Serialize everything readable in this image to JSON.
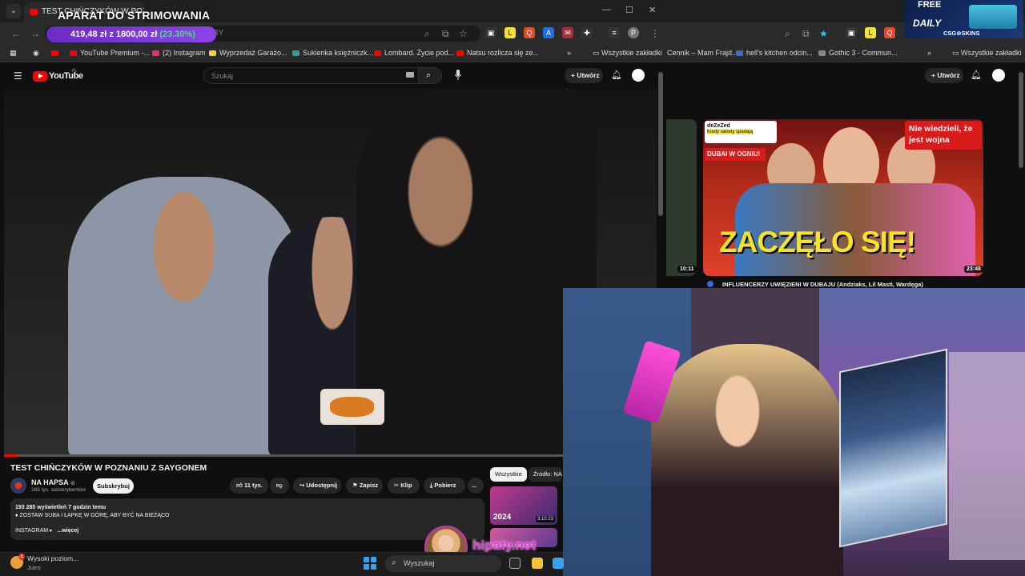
{
  "left_browser": {
    "tab_title": "TEST CHIŃCZYKÓW W POZ",
    "overlay_title": "APARAT DO STRIMOWANIA",
    "address_hint": "tchAggrdBY",
    "money": {
      "amount": "419,48 zł z 1800,00 zł",
      "percent": "(23.30%)"
    },
    "bookmarks": [
      "YouTube Premium -...",
      "(2) Instagram",
      "Wyprzedaż Garażo...",
      "Sukienka księżniczk...",
      "Lombard. Życie pod...",
      "Natsu rozlicza się ze...",
      "Wszystkie zakładki"
    ]
  },
  "youtube": {
    "logo": "YouTube",
    "logo_region": "PL",
    "search_placeholder": "Szukaj",
    "create_label": "Utwórz",
    "video": {
      "title": "TEST CHIŃCZYKÓW W POZNANIU Z SAYGONEM",
      "progress_fraction": 0.02,
      "channel": "NA HAPSA",
      "subscribers": "265 tys. subskrybentów",
      "subscribe_label": "Subskrybuj",
      "likes": "11 tys.",
      "share_label": "Udostępnij",
      "save_label": "Zapisz",
      "clip_label": "Klip",
      "download_label": "Pobierz",
      "more_label": "...",
      "views_time": "193 285 wyświetleń  7 godzin temu",
      "desc_line": "♦ ZOSTAW SUBA I ŁAPKĘ W GÓRĘ, ABY BYĆ NA BIEŻĄCO",
      "desc_instagram": "INSTAGRAM ▸",
      "more_desc": "...więcej"
    },
    "chips": [
      "Wszystkie",
      "Źródło: NA I"
    ],
    "side_thumb": {
      "label": "2024",
      "duration": "3:10:23"
    }
  },
  "right_browser": {
    "bookmarks": [
      "Cennik – Mam Frajd...",
      "hell's kitchen odcin...",
      "Gothic 3 - Commun...",
      "Wszystkie zakładki"
    ],
    "create_label": "Utwórz",
    "ad": {
      "free": "FREE",
      "daily": "DAILY",
      "brand": "CSG⊕SKINS"
    },
    "video": {
      "thumb_text": "ZACZĘŁO SIĘ!",
      "badge_text": "Nie wiedzieli, że jest wojna",
      "dubai_label": "DUBAI W OGNIU!",
      "tweet_name": "deZeZed",
      "tweet_line": "Kiedy rakiety spadają",
      "duration": "23:48",
      "left_duration": "10:11",
      "title": "INFLUENCERZY UWIĘZIENI W DUBAJU (Andziaks, Lil Masti, Wardęga)"
    }
  },
  "watermark": "hipaty.net",
  "taskbar": {
    "notif_title": "Wysoki poziom...",
    "notif_sub": "Jutro",
    "notif_count": "1",
    "search_label": "Wyszukaj"
  }
}
